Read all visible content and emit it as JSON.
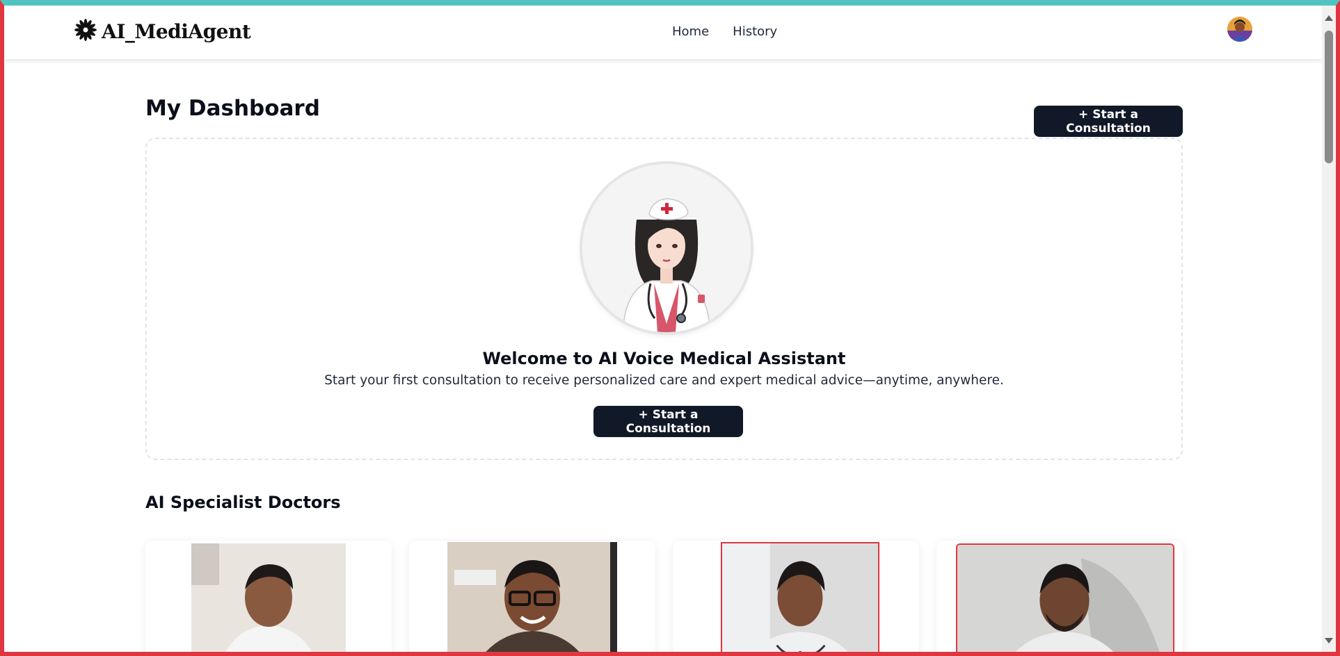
{
  "navbar": {
    "logo_text": "AI_MediAgent",
    "links": [
      {
        "label": "Home"
      },
      {
        "label": "History"
      }
    ]
  },
  "dashboard": {
    "title": "My Dashboard",
    "start_button_label": "+ Start a Consultation"
  },
  "welcome": {
    "title": "Welcome to AI Voice Medical Assistant",
    "subtitle": "Start your first consultation to receive personalized care and expert medical advice—anytime, anywhere.",
    "button_label": "+ Start a Consultation"
  },
  "specialists": {
    "title": "AI Specialist Doctors"
  },
  "colors": {
    "primary_button": "#111827",
    "highlight_border": "#e0363f",
    "frame_top": "#4fc3c0"
  }
}
